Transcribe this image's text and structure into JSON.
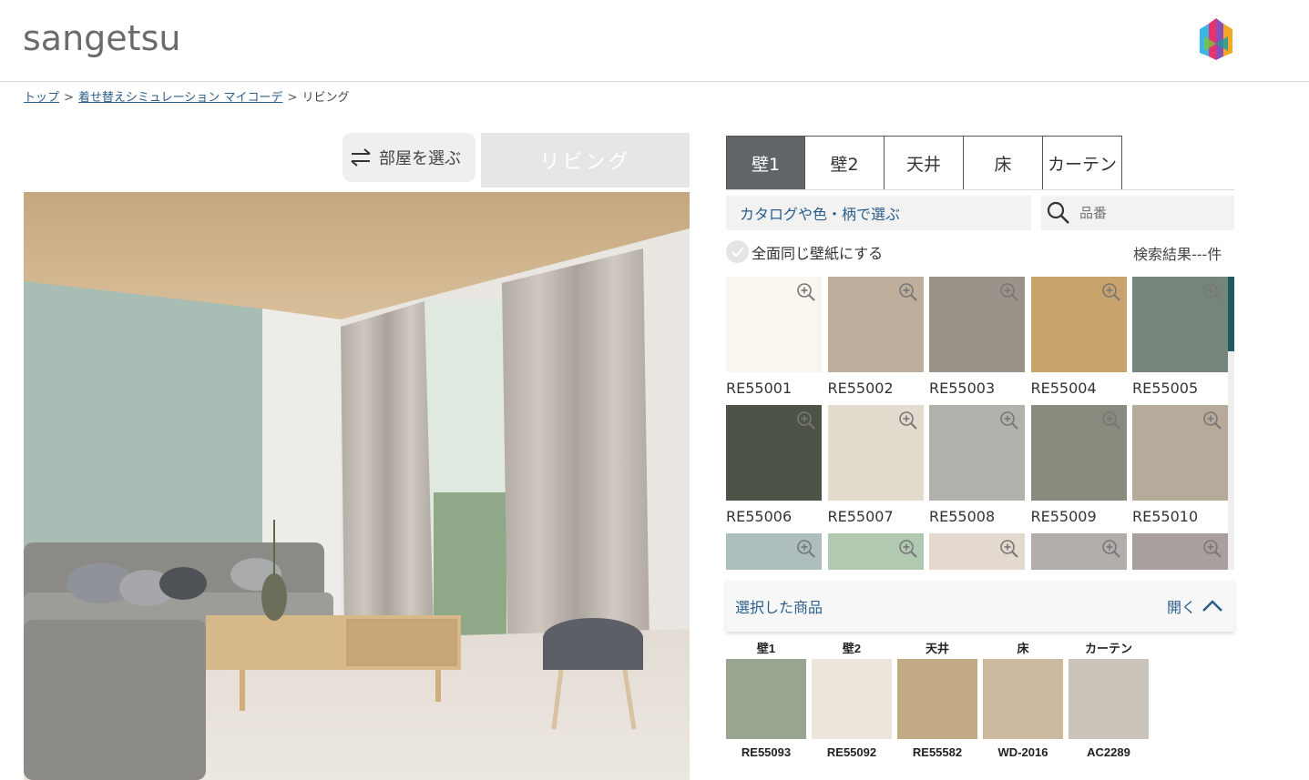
{
  "header": {
    "logo": "sangetsu"
  },
  "breadcrumb": {
    "items": [
      "トップ",
      "着せ替えシミュレーション マイコーデ"
    ],
    "current": "リビング",
    "separator": ">"
  },
  "room": {
    "select_label": "部屋を選ぶ",
    "current_room": "リビング"
  },
  "tabs": [
    "壁1",
    "壁2",
    "天井",
    "床",
    "カーテン"
  ],
  "search": {
    "catalog_label": "カタログや色・柄で選ぶ",
    "placeholder": "品番"
  },
  "same_wall_label": "全面同じ壁紙にする",
  "result_count": "検索結果---件",
  "swatches": [
    {
      "code": "RE55001",
      "color": "#f8f6ee"
    },
    {
      "code": "RE55002",
      "color": "#bfae9c"
    },
    {
      "code": "RE55003",
      "color": "#9b938a"
    },
    {
      "code": "RE55004",
      "color": "#c9a36c"
    },
    {
      "code": "RE55005",
      "color": "#76857a"
    },
    {
      "code": "RE55006",
      "color": "#4e5347"
    },
    {
      "code": "RE55007",
      "color": "#e4dbcf"
    },
    {
      "code": "RE55008",
      "color": "#b3b1ac"
    },
    {
      "code": "RE55009",
      "color": "#8a8a7f"
    },
    {
      "code": "RE55010",
      "color": "#b6aa9b"
    },
    {
      "code": "",
      "color": "#aebdbd"
    },
    {
      "code": "",
      "color": "#b1c8b1"
    },
    {
      "code": "",
      "color": "#e3d9cf"
    },
    {
      "code": "",
      "color": "#b3aeab"
    },
    {
      "code": "",
      "color": "#a99f9c"
    }
  ],
  "selected_panel": {
    "label": "選択した商品",
    "open_label": "開く"
  },
  "selected_items": [
    {
      "category": "壁1",
      "code": "RE55093",
      "color": "#9aa591"
    },
    {
      "category": "壁2",
      "code": "RE55092",
      "color": "#ece6dc"
    },
    {
      "category": "天井",
      "code": "RE55582",
      "color": "#c2aa84"
    },
    {
      "category": "床",
      "code": "WD-2016",
      "color": "#cdb9a0"
    },
    {
      "category": "カーテン",
      "code": "AC2289",
      "color": "#cbc4ba"
    }
  ]
}
